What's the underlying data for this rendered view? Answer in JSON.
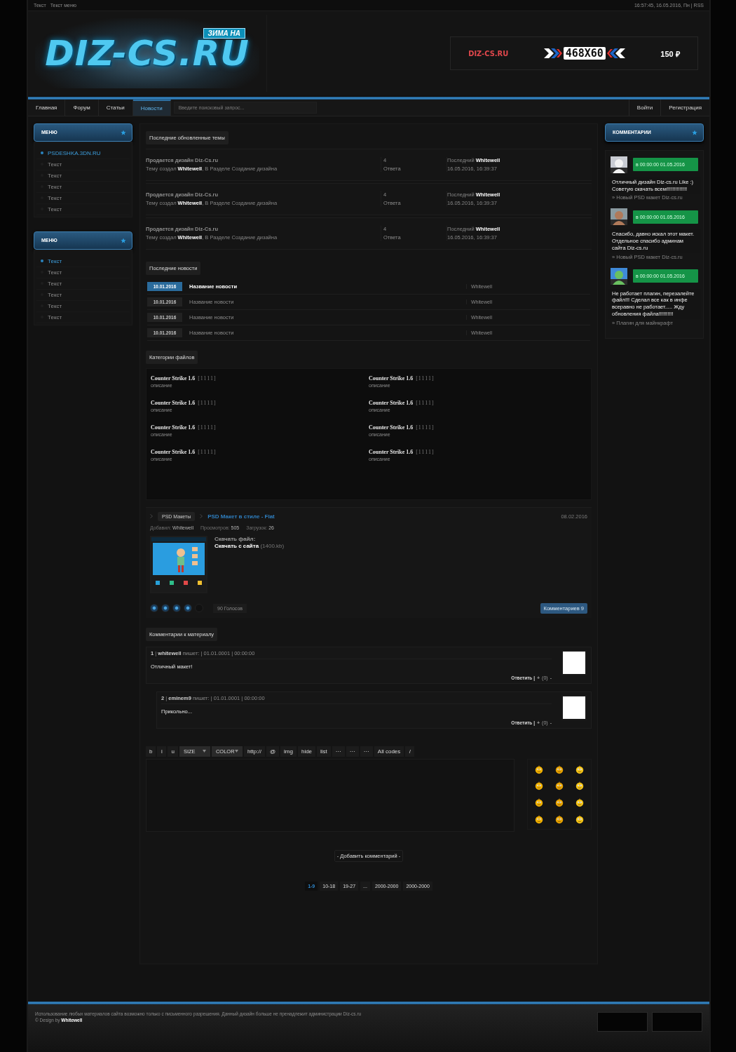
{
  "topbar": {
    "links": [
      "Текст",
      "Текст меню"
    ],
    "datetime": "16:57:45, 16.05.2016, Пн | RSS"
  },
  "header": {
    "logo": {
      "tag": "ЗИМА НА",
      "name": "DIZ-CS.RU"
    },
    "banner": {
      "brand": "DIZ-CS.RU",
      "size": "468X60",
      "price": "150 ₽"
    }
  },
  "nav": {
    "items": [
      {
        "label": "Главная",
        "selected": false
      },
      {
        "label": "Форум",
        "selected": false
      },
      {
        "label": "Статьи",
        "selected": false
      },
      {
        "label": "Новости",
        "selected": true
      }
    ],
    "search": {
      "placeholder": "Введите поисковый запрос..."
    },
    "right": [
      "Войти",
      "Регистрация"
    ]
  },
  "left_menus": [
    {
      "title": "МЕНЮ",
      "items": [
        {
          "label": "PSDESHKA.3DN.RU",
          "selected": true
        },
        {
          "label": "Текст",
          "selected": false
        },
        {
          "label": "Текст",
          "selected": false
        },
        {
          "label": "Текст",
          "selected": false
        },
        {
          "label": "Текст",
          "selected": false
        },
        {
          "label": "Текст",
          "selected": false
        }
      ]
    },
    {
      "title": "МЕНЮ",
      "items": [
        {
          "label": "Текст",
          "selected": true
        },
        {
          "label": "Текст",
          "selected": false
        },
        {
          "label": "Текст",
          "selected": false
        },
        {
          "label": "Текст",
          "selected": false
        },
        {
          "label": "Текст",
          "selected": false
        },
        {
          "label": "Текст",
          "selected": false
        }
      ]
    }
  ],
  "topics": {
    "title": "Последние обновленные темы",
    "rows": [
      {
        "title": "Продается дизайн Diz-Cs.ru",
        "info": "Тему создал **Whitewell**, В Разделе Создание дизайна",
        "count": "4",
        "count_label": "Ответа",
        "last": "Последний **Whitewell**",
        "date": "16.05.2016, 16:39:37"
      },
      {
        "title": "Продается дизайн Diz-Cs.ru",
        "info": "Тему создал **Whitewell**, В Разделе Создание дизайна",
        "count": "4",
        "count_label": "Ответа",
        "last": "Последний **Whitewell**",
        "date": "16.05.2016, 16:39:37"
      },
      {
        "title": "Продается дизайн Diz-Cs.ru",
        "info": "Тему создал **Whitewell**, В Разделе Создание дизайна",
        "count": "4",
        "count_label": "Ответа",
        "last": "Последний **Whitewell**",
        "date": "16.05.2016, 16:39:37"
      }
    ]
  },
  "news": {
    "title": "Последние новости",
    "rows": [
      {
        "date": "10.01.2016",
        "title": "Название новости",
        "author": "Whitewell",
        "selected": true
      },
      {
        "date": "10.01.2016",
        "title": "Название новости",
        "author": "Whitewell",
        "selected": false
      },
      {
        "date": "10.01.2016",
        "title": "Название новости",
        "author": "Whitewell",
        "selected": false
      },
      {
        "date": "10.01.2016",
        "title": "Название новости",
        "author": "Whitewell",
        "selected": false
      }
    ]
  },
  "categories": {
    "title": "Категории файлов",
    "items": [
      {
        "name": "Counter Strike 1.6",
        "count": "[1111]",
        "description": "описание"
      },
      {
        "name": "Counter Strike 1.6",
        "count": "[1111]",
        "description": "описание"
      },
      {
        "name": "Counter Strike 1.6",
        "count": "[1111]",
        "description": "описание"
      },
      {
        "name": "Counter Strike 1.6",
        "count": "[1111]",
        "description": "описание"
      },
      {
        "name": "Counter Strike 1.6",
        "count": "[1111]",
        "description": "описание"
      },
      {
        "name": "Counter Strike 1.6",
        "count": "[1111]",
        "description": "описание"
      },
      {
        "name": "Counter Strike 1.6",
        "count": "[1111]",
        "description": "описание"
      },
      {
        "name": "Counter Strike 1.6",
        "count": "[1111]",
        "description": "описание"
      }
    ]
  },
  "material": {
    "category": "PSD Макеты",
    "title": "PSD Макет в стиле - Flat",
    "date": "08.02.2016",
    "meta": [
      {
        "label": "Добавил:",
        "value": "Whitewell"
      },
      {
        "label": "Просмотров:",
        "value": "505"
      },
      {
        "label": "Загрузок:",
        "value": "26"
      }
    ],
    "download_label": "Скачать файл:",
    "download_link": "Скачать с сайта",
    "download_size": "(1400.kb)",
    "rating": {
      "stars": 4
    },
    "votes": "90 Голосов",
    "comments_button": "Комментариев 9"
  },
  "comments": {
    "title": "Комментарии к материалу",
    "items": [
      {
        "header": "**1** | **whitewell** пишет: | 01.01.0001 | 00:00:00",
        "text": "Отличный макет!",
        "reply": "Ответить |",
        "plus": "+",
        "score": "(0)",
        "minus": "-",
        "children": [
          {
            "header": "**2** | **eminem9** пишет: | 01.01.0001 | 00:00:00",
            "text": "Прикольно...",
            "reply": "Ответить |",
            "plus": "+",
            "score": "(0)",
            "minus": "-"
          }
        ]
      }
    ]
  },
  "editor": {
    "tools": [
      {
        "kind": "button",
        "label": "b"
      },
      {
        "kind": "button",
        "label": "i"
      },
      {
        "kind": "button",
        "label": "u"
      },
      {
        "kind": "select",
        "label": "SIZE"
      },
      {
        "kind": "select",
        "label": "COLOR"
      },
      {
        "kind": "button",
        "label": "http://"
      },
      {
        "kind": "button",
        "label": "@"
      },
      {
        "kind": "button",
        "label": "img"
      },
      {
        "kind": "button",
        "label": "hide"
      },
      {
        "kind": "button",
        "label": "list"
      },
      {
        "kind": "button",
        "label": "···"
      },
      {
        "kind": "button",
        "label": "···"
      },
      {
        "kind": "button",
        "label": "···"
      },
      {
        "kind": "button",
        "label": "All codes"
      },
      {
        "kind": "button",
        "label": "/"
      }
    ],
    "submit": "- Добавить комментарий -"
  },
  "pagination": [
    {
      "label": "1-9",
      "selected": true
    },
    {
      "label": "10-18",
      "selected": false
    },
    {
      "label": "19-27",
      "selected": false
    },
    {
      "label": "...",
      "selected": false
    },
    {
      "label": "2000-2000",
      "selected": false
    },
    {
      "label": "2000-2000",
      "selected": false
    }
  ],
  "right_panel": {
    "title": "КОММЕНТАРИИ",
    "items": [
      {
        "time": "в 00:00:00  01.05.2016",
        "text": "Отличный дизайн Diz-cs.ru Like :) Советую скачать всем!!!!!!!!!!!!!!",
        "link": "» Новый PSD макет Diz-cs.ru"
      },
      {
        "time": "в 00:00:00  01.05.2016",
        "text": "Спасибо, давно искал этот макет. Отдельное спасибо админам сайта Diz-cs.ru",
        "link": "» Новый PSD макет Diz-cs.ru"
      },
      {
        "time": "в 00:00:00  01.05.2016",
        "text": "Не работает плагин, перезалейте файл!!! Сделал все как в инфе всеравно не работает.....  Жду обновления файла!!!!!!!!!!",
        "link": "» Плагин для майнкрафт"
      }
    ]
  },
  "footer": {
    "notice": "Использование любых материалов сайта возможно только с письменного разрешения. Данный дизайн больше не пренадлежит администрации Diz-cs.ru",
    "credit": "© Design by **Whitewell**"
  }
}
